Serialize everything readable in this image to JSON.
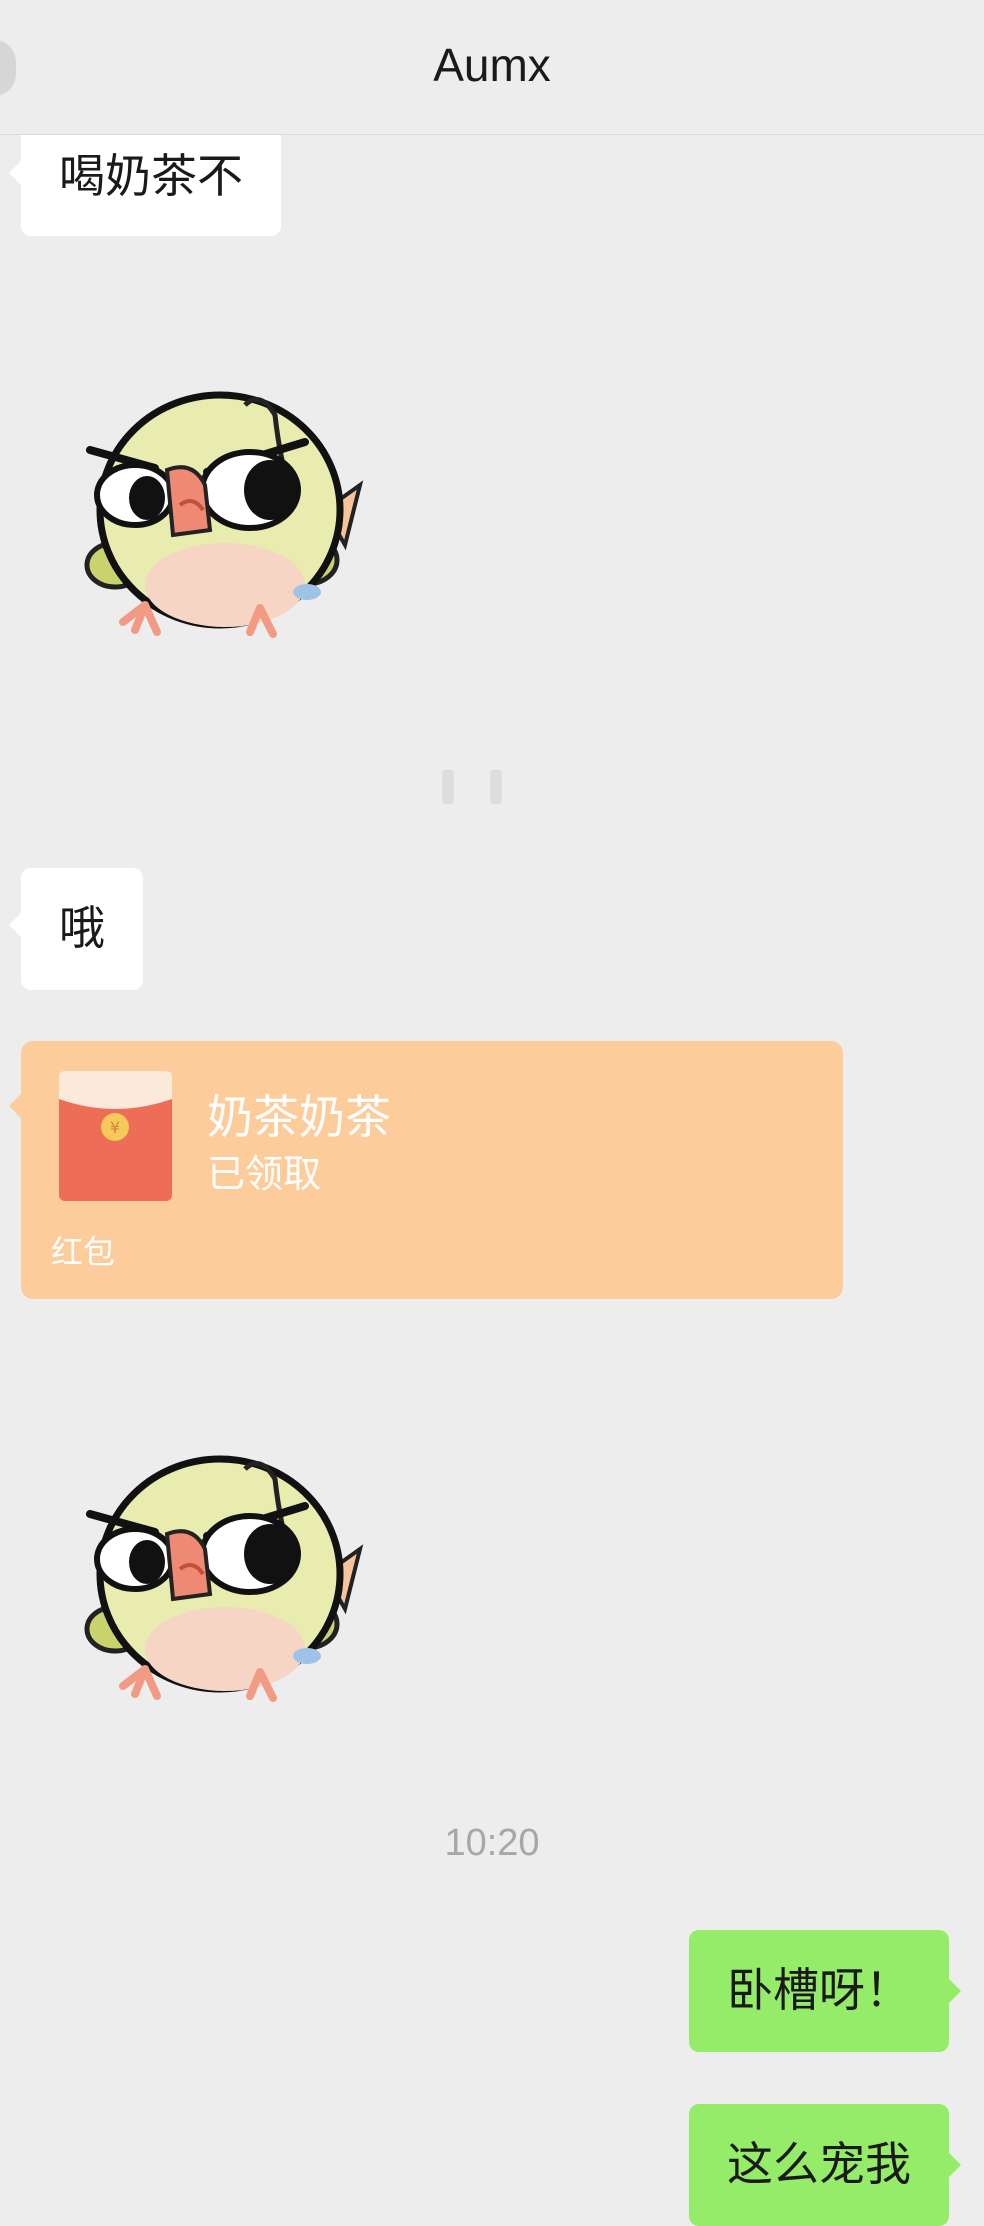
{
  "header": {
    "title": "Aumx"
  },
  "messages": {
    "m1": "喝奶茶不",
    "m2": "哦",
    "m3": "卧槽呀！",
    "m4": "这么宠我"
  },
  "red_packet": {
    "title": "奶茶奶茶",
    "status": "已领取",
    "label": "红包"
  },
  "timestamp": "10:20",
  "colors": {
    "background": "#ededed",
    "incoming_bubble": "#ffffff",
    "outgoing_bubble": "#95ec69",
    "red_packet": "#fccc9b"
  },
  "icons": {
    "sticker": "angry-bird-sticker",
    "red_packet": "red-envelope-icon"
  }
}
